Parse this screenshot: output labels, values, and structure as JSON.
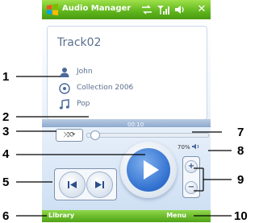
{
  "app": {
    "title": "Audio Manager",
    "close_glyph": "✕"
  },
  "track": {
    "title": "Track02",
    "artist": "John",
    "album": "Collection 2006",
    "genre": "Pop"
  },
  "playback": {
    "elapsed": "00:10",
    "progress_fraction": 0.06,
    "shuffle_label": "⤨⟳"
  },
  "volume": {
    "label": "70%",
    "level_percent": 70
  },
  "softkeys": {
    "left": "Library",
    "right": "Menu"
  },
  "callouts": [
    "1",
    "2",
    "3",
    "4",
    "5",
    "6",
    "7",
    "8",
    "9",
    "10"
  ],
  "colors": {
    "title_bar": "#5fb51d",
    "play_button": "#2f6fcf",
    "text": "#5a6f8e"
  },
  "icons": {
    "artist": "person-icon",
    "album": "disc-icon",
    "genre": "music-note-icon"
  }
}
